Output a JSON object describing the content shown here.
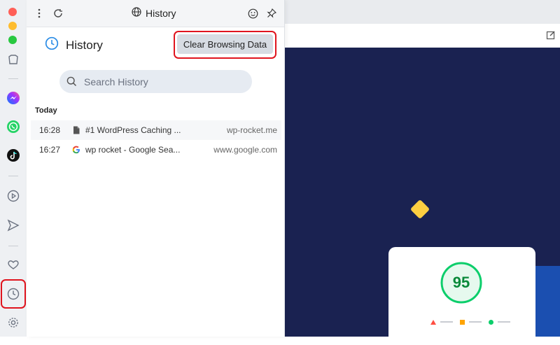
{
  "panel": {
    "header_title": "History",
    "title": "History",
    "clear_button_label": "Clear Browsing Data",
    "search_placeholder": "Search History",
    "group_label": "Today",
    "entries": [
      {
        "time": "16:28",
        "title": "#1 WordPress Caching ...",
        "domain": "wp-rocket.me",
        "favicon": "document-icon"
      },
      {
        "time": "16:27",
        "title": "wp rocket - Google Sea...",
        "domain": "www.google.com",
        "favicon": "google-icon"
      }
    ]
  },
  "sidebar": {
    "items": [
      "shirt-icon",
      "messenger-icon",
      "whatsapp-icon",
      "tiktok-icon",
      "play-icon",
      "send-icon",
      "heart-icon",
      "history-clock-icon",
      "settings-gear-icon"
    ],
    "highlight_color": "#e0141e"
  },
  "page": {
    "score": "95",
    "score_color": "#0cce6b",
    "background_color": "#1a2251",
    "diamond_color": "#fdcf41"
  }
}
